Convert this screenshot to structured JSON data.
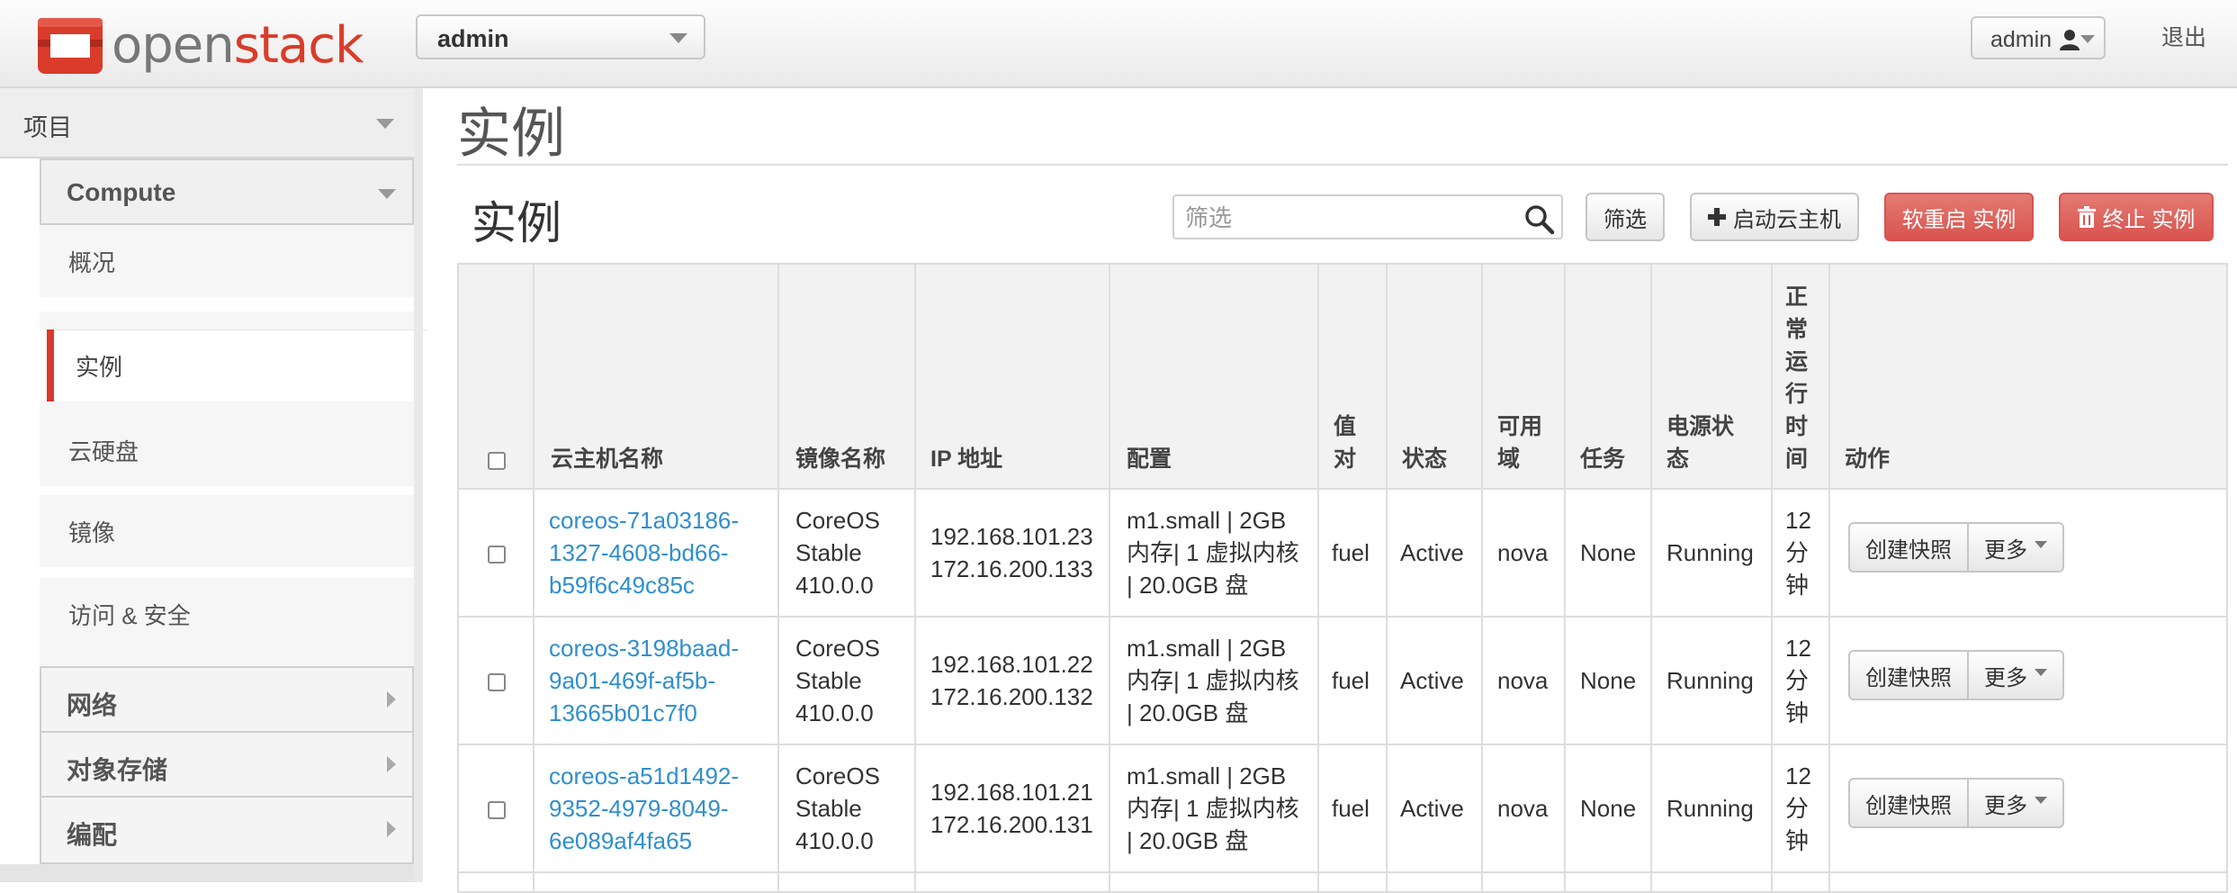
{
  "header": {
    "brand_open": "open",
    "brand_stack": "stack",
    "project_selector": "admin",
    "user_menu": "admin",
    "logout": "退出"
  },
  "sidebar": {
    "project_label": "项目",
    "compute_label": "Compute",
    "items": [
      {
        "label": "概况",
        "active": false
      },
      {
        "label": "实例",
        "active": true
      },
      {
        "label": "云硬盘",
        "active": false
      },
      {
        "label": "镜像",
        "active": false
      },
      {
        "label": "访问 & 安全",
        "active": false
      }
    ],
    "groups": [
      "网络",
      "对象存储",
      "编配"
    ]
  },
  "main": {
    "page_title": "实例",
    "table_title": "实例",
    "filter_placeholder": "筛选",
    "filter_button": "筛选",
    "launch_button": "启动云主机",
    "reboot_button": "软重启 实例",
    "terminate_button": "终止 实例"
  },
  "table": {
    "columns": {
      "name": "云主机名称",
      "image": "镜像名称",
      "ip": "IP 地址",
      "flavor": "配置",
      "keypair": [
        "值",
        "对"
      ],
      "status": "状态",
      "az": [
        "可用",
        "域"
      ],
      "task": "任务",
      "power": [
        "电源状",
        "态"
      ],
      "uptime": [
        "正",
        "常",
        "运",
        "行",
        "时",
        "间"
      ],
      "actions": "动作"
    },
    "rows": [
      {
        "name": [
          "coreos-71a03186-",
          "1327-4608-bd66-",
          "b59f6c49c85c"
        ],
        "image": [
          "CoreOS",
          "Stable",
          "410.0.0"
        ],
        "ip": [
          "192.168.101.23",
          "172.16.200.133"
        ],
        "flavor": [
          "m1.small | 2GB",
          "内存| 1 虚拟内核",
          "| 20.0GB 盘"
        ],
        "keypair": "fuel",
        "status": "Active",
        "az": "nova",
        "task": "None",
        "power": "Running",
        "uptime": [
          "12",
          "分",
          "钟"
        ],
        "snapshot": "创建快照",
        "more": "更多"
      },
      {
        "name": [
          "coreos-3198baad-",
          "9a01-469f-af5b-",
          "13665b01c7f0"
        ],
        "image": [
          "CoreOS",
          "Stable",
          "410.0.0"
        ],
        "ip": [
          "192.168.101.22",
          "172.16.200.132"
        ],
        "flavor": [
          "m1.small | 2GB",
          "内存| 1 虚拟内核",
          "| 20.0GB 盘"
        ],
        "keypair": "fuel",
        "status": "Active",
        "az": "nova",
        "task": "None",
        "power": "Running",
        "uptime": [
          "12",
          "分",
          "钟"
        ],
        "snapshot": "创建快照",
        "more": "更多"
      },
      {
        "name": [
          "coreos-a51d1492-",
          "9352-4979-8049-",
          "6e089af4fa65"
        ],
        "image": [
          "CoreOS",
          "Stable",
          "410.0.0"
        ],
        "ip": [
          "192.168.101.21",
          "172.16.200.131"
        ],
        "flavor": [
          "m1.small | 2GB",
          "内存| 1 虚拟内核",
          "| 20.0GB 盘"
        ],
        "keypair": "fuel",
        "status": "Active",
        "az": "nova",
        "task": "None",
        "power": "Running",
        "uptime": [
          "12",
          "分",
          "钟"
        ],
        "snapshot": "创建快照",
        "more": "更多"
      }
    ]
  },
  "colors": {
    "accent_red": "#d9382b",
    "danger_button": "#d9534f",
    "link_blue": "#2f8fce"
  },
  "icons": [
    "openstack-logo-icon",
    "user-icon",
    "search-icon",
    "plus-icon",
    "trash-icon",
    "chevron-down-icon",
    "chevron-right-icon"
  ]
}
